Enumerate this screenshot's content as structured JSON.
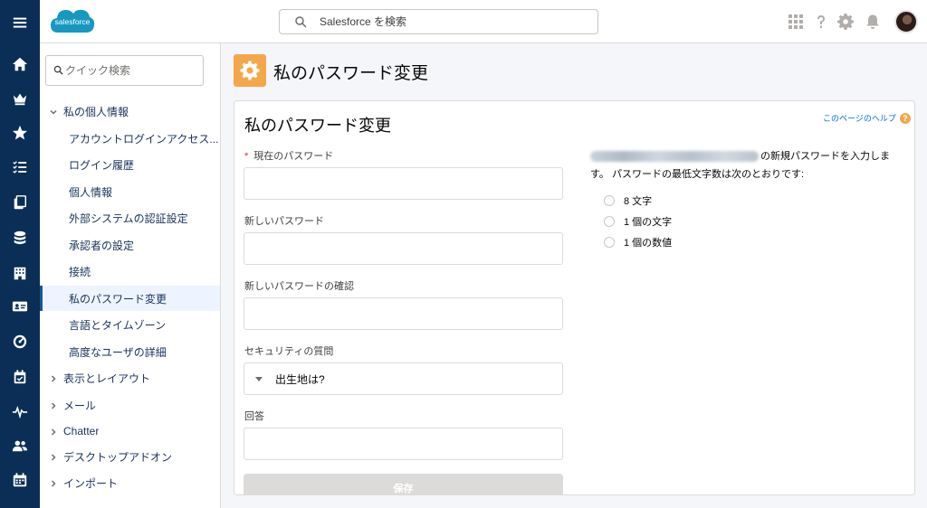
{
  "header": {
    "logo_text": "salesforce",
    "search_placeholder": "Salesforce を検索"
  },
  "rail": {
    "icons": [
      "menu-icon",
      "home-icon",
      "crown-icon",
      "star-icon",
      "checklist-icon",
      "files-icon",
      "records-icon",
      "building-icon",
      "contact-card-icon",
      "dashboard-icon",
      "calendar-check-icon",
      "pulse-icon",
      "people-icon",
      "calendar-icon"
    ]
  },
  "sidebar": {
    "quick_search_placeholder": "クイック検索",
    "section": "私の個人情報",
    "items": [
      "アカウントログインアクセス...",
      "ログイン履歴",
      "個人情報",
      "外部システムの認証設定",
      "承認者の設定",
      "接続",
      "私のパスワード変更",
      "言語とタイムゾーン",
      "高度なユーザの詳細"
    ],
    "groups": [
      "表示とレイアウト",
      "メール",
      "Chatter",
      "デスクトップアドオン",
      "インポート"
    ]
  },
  "page": {
    "title": "私のパスワード変更"
  },
  "card": {
    "title": "私のパスワード変更",
    "help_link": "このページのヘルプ",
    "help_icon": "?",
    "fields": {
      "current_password_label": "現在のパスワード",
      "required_mark": "*",
      "new_password_label": "新しいパスワード",
      "confirm_password_label": "新しいパスワードの確認",
      "security_question_label": "セキュリティの質問",
      "security_question_value": "出生地は?",
      "answer_label": "回答"
    },
    "save_label": "保存",
    "info_line1": "の新規パスワードを入力しま",
    "info_line2": "す。 パスワードの最低文字数は次のとおりです:",
    "rules": [
      "8 文字",
      "1 個の文字",
      "1 個の数値"
    ]
  },
  "colors": {
    "rail_bg": "#0a2e55",
    "accent": "#1b5297",
    "page_icon_bg": "#f4a74a",
    "link": "#0070d2",
    "required": "#c23934"
  }
}
